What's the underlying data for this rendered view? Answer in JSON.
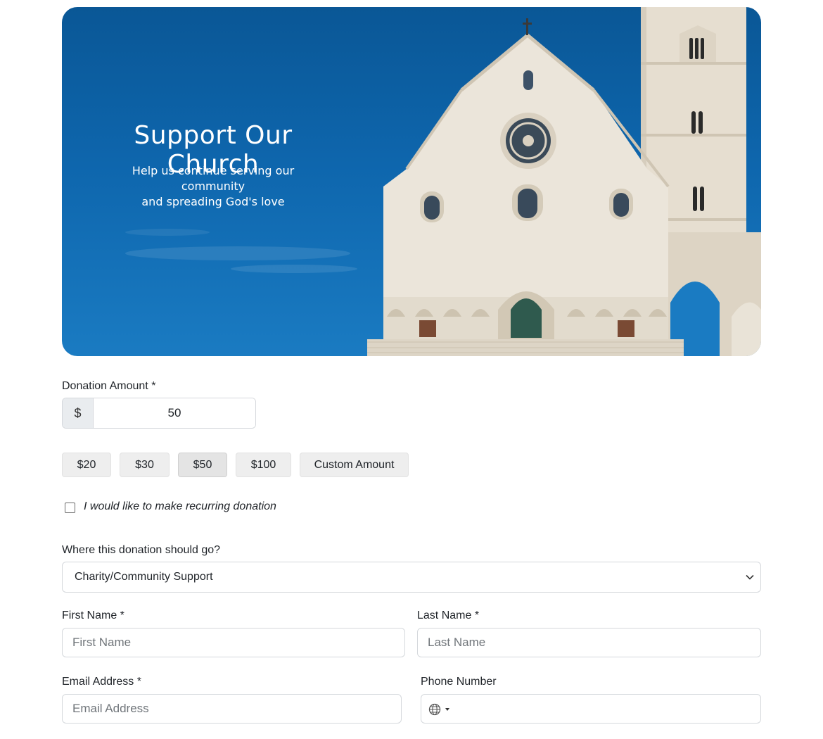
{
  "hero": {
    "title": "Support Our Church",
    "subtitle_line1": "Help us continue serving our community",
    "subtitle_line2": "and spreading God's love"
  },
  "donation": {
    "label": "Donation Amount *",
    "currency_symbol": "$",
    "amount_value": "50",
    "presets": [
      "$20",
      "$30",
      "$50",
      "$100",
      "Custom Amount"
    ],
    "selected_preset": "$50"
  },
  "recurring": {
    "label": "I would like to make recurring donation",
    "checked": false
  },
  "destination": {
    "label": "Where this donation should go?",
    "selected": "Charity/Community Support",
    "icon": "chevron-down-icon"
  },
  "first_name": {
    "label": "First Name *",
    "placeholder": "First Name"
  },
  "last_name": {
    "label": "Last Name *",
    "placeholder": "Last Name"
  },
  "email": {
    "label": "Email Address *",
    "placeholder": "Email Address"
  },
  "phone": {
    "label": "Phone Number",
    "icon": "globe-icon"
  },
  "colors": {
    "sky": "#0e66ad",
    "stone": "#e8e1d5",
    "button_bg": "#eeeeee",
    "border": "#d5d8dc"
  }
}
